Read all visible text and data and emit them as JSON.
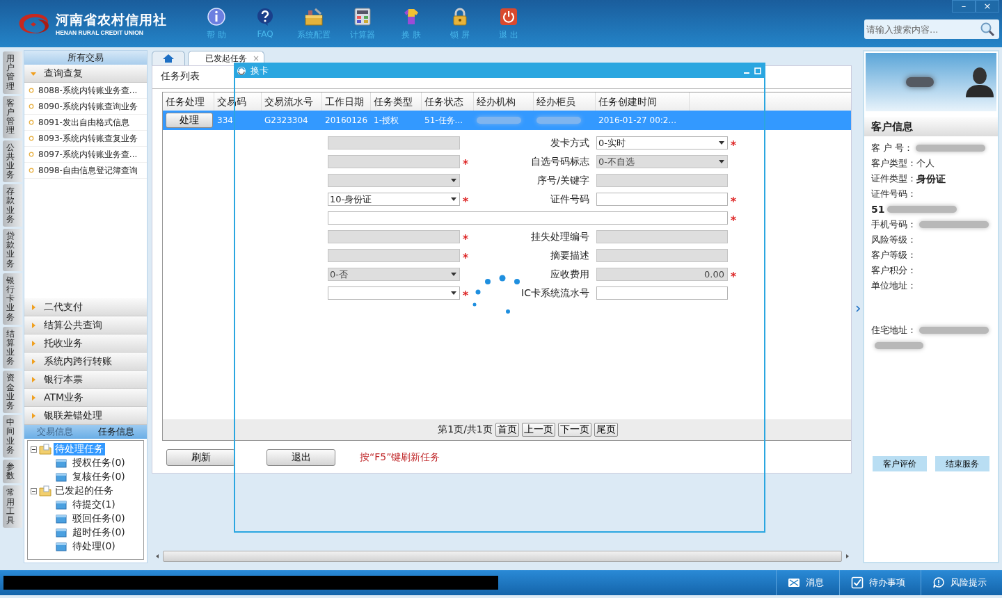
{
  "header": {
    "logo_title": "河南省农村信用社",
    "logo_subtitle": "HENAN RURAL CREDIT UNION",
    "toolbar": [
      {
        "label": "帮 助",
        "kind": "info"
      },
      {
        "label": "FAQ",
        "kind": "faq"
      },
      {
        "label": "系统配置",
        "kind": "config"
      },
      {
        "label": "计算器",
        "kind": "calc"
      },
      {
        "label": "换 肤",
        "kind": "skin"
      },
      {
        "label": "锁 屏",
        "kind": "lock"
      },
      {
        "label": "退 出",
        "kind": "exit"
      }
    ],
    "window_controls": [
      "–",
      "×"
    ],
    "search": {
      "placeholder": "请输入搜索内容..."
    }
  },
  "module_tabs": [
    "用户管理",
    "客户管理",
    "公共业务",
    "存款业务",
    "贷款业务",
    "银行卡业务",
    "结算业务",
    "资金业务",
    "中间业务",
    "参数",
    "常用工具"
  ],
  "sidebar": {
    "title": "所有交易",
    "groups": [
      {
        "label": "查询查复",
        "expanded": true,
        "items": [
          "8088-系统内转账业务查...",
          "8090-系统内转账查询业务",
          "8091-发出自由格式信息",
          "8093-系统内转账查复业务",
          "8097-系统内转账业务查...",
          "8098-自由信息登记簿查询"
        ]
      },
      {
        "label": "二代支付",
        "expanded": false
      },
      {
        "label": "结算公共查询",
        "expanded": false
      },
      {
        "label": "托收业务",
        "expanded": false
      },
      {
        "label": "系统内跨行转账",
        "expanded": false
      },
      {
        "label": "银行本票",
        "expanded": false
      },
      {
        "label": "ATM业务",
        "expanded": false
      },
      {
        "label": "银联差错处理",
        "expanded": false
      }
    ]
  },
  "task_tree": {
    "tabs": [
      {
        "label": "交易信息",
        "selected": false
      },
      {
        "label": "任务信息",
        "selected": true
      }
    ],
    "nodes": [
      {
        "label": "待处理任务",
        "selected": true,
        "expanded": true,
        "children": [
          {
            "label": "授权任务(0)",
            "selected": false
          },
          {
            "label": "复核任务(0)",
            "selected": false
          }
        ]
      },
      {
        "label": "已发起的任务",
        "selected": false,
        "expanded": true,
        "children": [
          {
            "label": "待提交(1)",
            "selected": false
          },
          {
            "label": "驳回任务(0)",
            "selected": false
          },
          {
            "label": "超时任务(0)",
            "selected": false
          },
          {
            "label": "待处理(0)",
            "selected": false
          }
        ]
      }
    ]
  },
  "tabs": [
    {
      "kind": "home",
      "selected": false
    },
    {
      "kind": "page",
      "label": "已发起任务",
      "close": "×",
      "selected": true
    }
  ],
  "task_list": {
    "title": "任务列表",
    "columns": [
      "任务处理",
      "交易码",
      "交易流水号",
      "工作日期",
      "任务类型",
      "任务状态",
      "经办机构",
      "经办柜员",
      "任务创建时间"
    ],
    "rows": [
      {
        "selected": true,
        "cells": [
          {
            "kind": "button",
            "text": "处理"
          },
          {
            "kind": "text",
            "text": "334"
          },
          {
            "kind": "text",
            "text": "G2323304"
          },
          {
            "kind": "text",
            "text": "20160126"
          },
          {
            "kind": "text",
            "text": "1-授权"
          },
          {
            "kind": "text",
            "text": "51-任务..."
          },
          {
            "kind": "masked"
          },
          {
            "kind": "masked"
          },
          {
            "kind": "text",
            "text": "2016-01-27 00:2..."
          }
        ]
      }
    ],
    "pager": {
      "text": "第1页/共1页",
      "buttons": [
        "首页",
        "上一页",
        "下一页",
        "尾页"
      ]
    },
    "buttons": [
      "刷新",
      "退出"
    ],
    "hint": "按“F5”键刷新任务"
  },
  "dialog": {
    "title": "换卡",
    "loading": true,
    "form": [
      {
        "kind": "pair",
        "left": {
          "kind": "input",
          "disabled": true,
          "required": false
        },
        "label": "发卡方式",
        "right": {
          "kind": "select",
          "value": "0-实时",
          "disabled": false,
          "required": true
        }
      },
      {
        "kind": "pair",
        "left": {
          "kind": "input",
          "disabled": true,
          "required": true
        },
        "label": "自选号码标志",
        "right": {
          "kind": "select",
          "value": "0-不自选",
          "disabled": true,
          "required": false
        }
      },
      {
        "kind": "pair",
        "left": {
          "kind": "select",
          "disabled": true,
          "required": false
        },
        "label": "序号/关键字",
        "right": {
          "kind": "input",
          "disabled": true,
          "required": false
        }
      },
      {
        "kind": "pair",
        "left": {
          "kind": "select",
          "value": "10-身份证",
          "disabled": false,
          "required": true
        },
        "label": "证件号码",
        "right": {
          "kind": "input",
          "disabled": false,
          "required": true
        }
      },
      {
        "kind": "wide",
        "field": {
          "kind": "input",
          "disabled": false,
          "required": true
        }
      },
      {
        "kind": "pair",
        "left": {
          "kind": "input",
          "disabled": true,
          "required": true
        },
        "label": "挂失处理编号",
        "right": {
          "kind": "input",
          "disabled": true,
          "required": false
        }
      },
      {
        "kind": "pair",
        "left": {
          "kind": "input",
          "disabled": true,
          "required": true
        },
        "label": "摘要描述",
        "right": {
          "kind": "input",
          "disabled": true,
          "required": false
        }
      },
      {
        "kind": "pair",
        "left": {
          "kind": "select",
          "value": "0-否",
          "disabled": true,
          "required": false
        },
        "label": "应收费用",
        "right": {
          "kind": "amount",
          "value": "0.00",
          "disabled": true,
          "required": true
        }
      },
      {
        "kind": "pair",
        "left": {
          "kind": "select",
          "disabled": false,
          "required": true
        },
        "label": "IC卡系统流水号",
        "right": {
          "kind": "input",
          "disabled": false,
          "required": false
        }
      }
    ]
  },
  "customer": {
    "title": "客户信息",
    "fields": [
      {
        "kind": "field",
        "label": "客 户 号：",
        "masked": true
      },
      {
        "kind": "field",
        "label": "客户类型：",
        "value": "个人",
        "bold": false
      },
      {
        "kind": "field",
        "label": "证件类型：",
        "value": "身份证",
        "bold": true
      },
      {
        "kind": "field",
        "label": "证件号码："
      },
      {
        "kind": "field",
        "value": "51",
        "bold": true,
        "masked": true
      },
      {
        "kind": "field",
        "label": "手机号码：",
        "masked": true
      },
      {
        "kind": "field",
        "label": "风险等级："
      },
      {
        "kind": "field",
        "label": "客户等级："
      },
      {
        "kind": "field",
        "label": "客户积分："
      },
      {
        "kind": "address",
        "label": "单位地址："
      },
      {
        "kind": "address",
        "label": "住宅地址：",
        "masked": true
      }
    ],
    "buttons": [
      "客户评价",
      "结束服务"
    ]
  },
  "status_bar": {
    "items": [
      {
        "kind": "message",
        "label": "消息"
      },
      {
        "kind": "todo",
        "label": "待办事项"
      },
      {
        "kind": "risk",
        "label": "风险提示"
      }
    ]
  }
}
